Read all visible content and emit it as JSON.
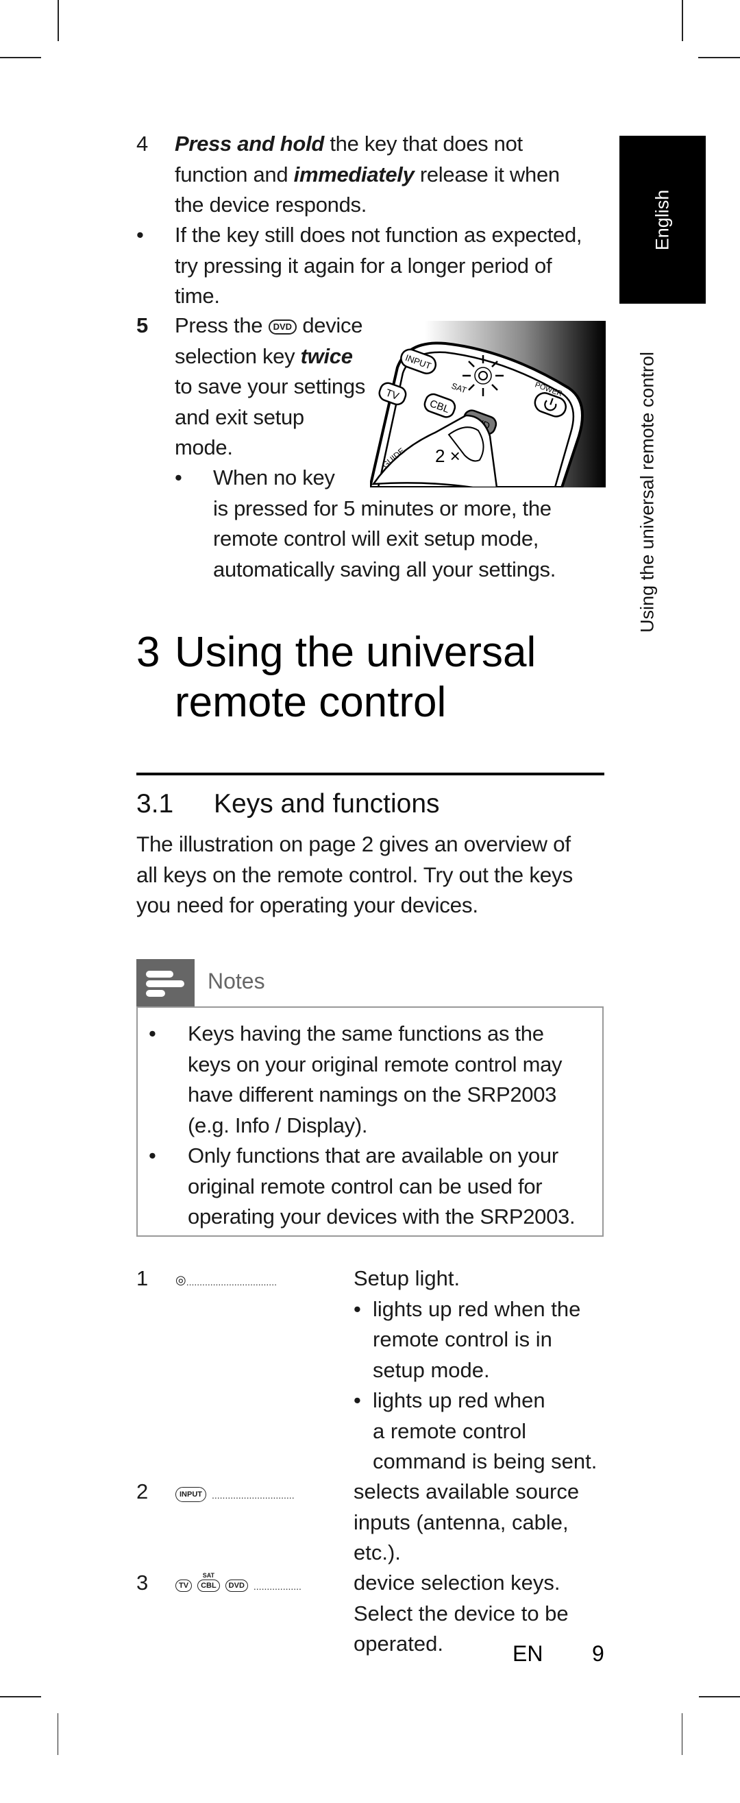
{
  "step4": {
    "number": "4",
    "lines": [
      {
        "parts": [
          {
            "t": "Press and hold",
            "bi": true
          },
          {
            "t": " the key that does not"
          }
        ]
      },
      {
        "parts": [
          {
            "t": "function and "
          },
          {
            "t": "immediately",
            "bi": true
          },
          {
            "t": " release it when"
          }
        ]
      },
      {
        "parts": [
          {
            "t": "the device responds."
          }
        ]
      }
    ],
    "bullet": {
      "symbol": "•",
      "lines": [
        "If the key still does not function as expected,",
        "try pressing it again for a longer period of",
        "time."
      ]
    }
  },
  "step5": {
    "number": "5",
    "line1_a": "Press the",
    "line1_key": "DVD",
    "line1_b": " device",
    "line2_a": "selection key ",
    "line2_b": "twice",
    "line3": "to save your settings",
    "line4": "and exit setup",
    "line5": "mode.",
    "bullet": {
      "symbol": "•",
      "lines": [
        "When no key",
        "is pressed for 5 minutes or more, the",
        "remote control will exit setup mode,",
        "automatically saving all your settings."
      ]
    },
    "illustration": {
      "keys": {
        "input": "INPUT",
        "tv": "TV",
        "sat": "SAT",
        "cbl": "CBL",
        "dvd": "DVD",
        "power": "POWER",
        "guide": "GUIDE"
      },
      "press_count": "2 ×",
      "highlight_color": "#7a7a7a"
    }
  },
  "chapter": {
    "number": "3",
    "title_line1": "Using the universal",
    "title_line2": "remote control"
  },
  "section": {
    "number": "3.1",
    "title": "Keys and functions",
    "intro_lines": [
      "The illustration on page 2 gives an overview of",
      "all keys on the remote control. Try out the keys",
      "you need for operating your devices."
    ]
  },
  "notes": {
    "label": "Notes",
    "icon": "notes-icon",
    "items": [
      {
        "symbol": "•",
        "lines": [
          "Keys having the same functions as the",
          "keys on your original remote control may",
          "have different namings on the SRP2003",
          "(e.g. Info / Display)."
        ]
      },
      {
        "symbol": "•",
        "lines": [
          "Only functions that are available on your",
          "original remote control can be used for",
          "operating your devices with the SRP2003."
        ]
      }
    ]
  },
  "key_table": [
    {
      "number": "1",
      "icon": "setup-light-icon",
      "icon_glyph": "◎",
      "dots": "..................................",
      "desc_lines": [
        "Setup light."
      ],
      "sub_bullets": [
        {
          "symbol": "•",
          "lines": [
            "lights up red when the",
            "remote control is in",
            "setup mode."
          ]
        },
        {
          "symbol": "•",
          "lines": [
            "lights up red when",
            "a remote control",
            "command is being sent."
          ]
        }
      ]
    },
    {
      "number": "2",
      "keys": [
        "INPUT"
      ],
      "dots": "...............................",
      "desc_lines": [
        "selects available source",
        "inputs (antenna, cable,",
        "etc.)."
      ]
    },
    {
      "number": "3",
      "keys": [
        "TV",
        "CBL",
        "DVD"
      ],
      "sat_label": "SAT",
      "dots": "..................",
      "desc_lines": [
        "device selection keys.",
        "Select the device to be",
        "operated."
      ]
    }
  ],
  "side_tab": {
    "language": "English",
    "chapter_title": "Using the universal remote control"
  },
  "footer": {
    "lang": "EN",
    "page": "9"
  }
}
